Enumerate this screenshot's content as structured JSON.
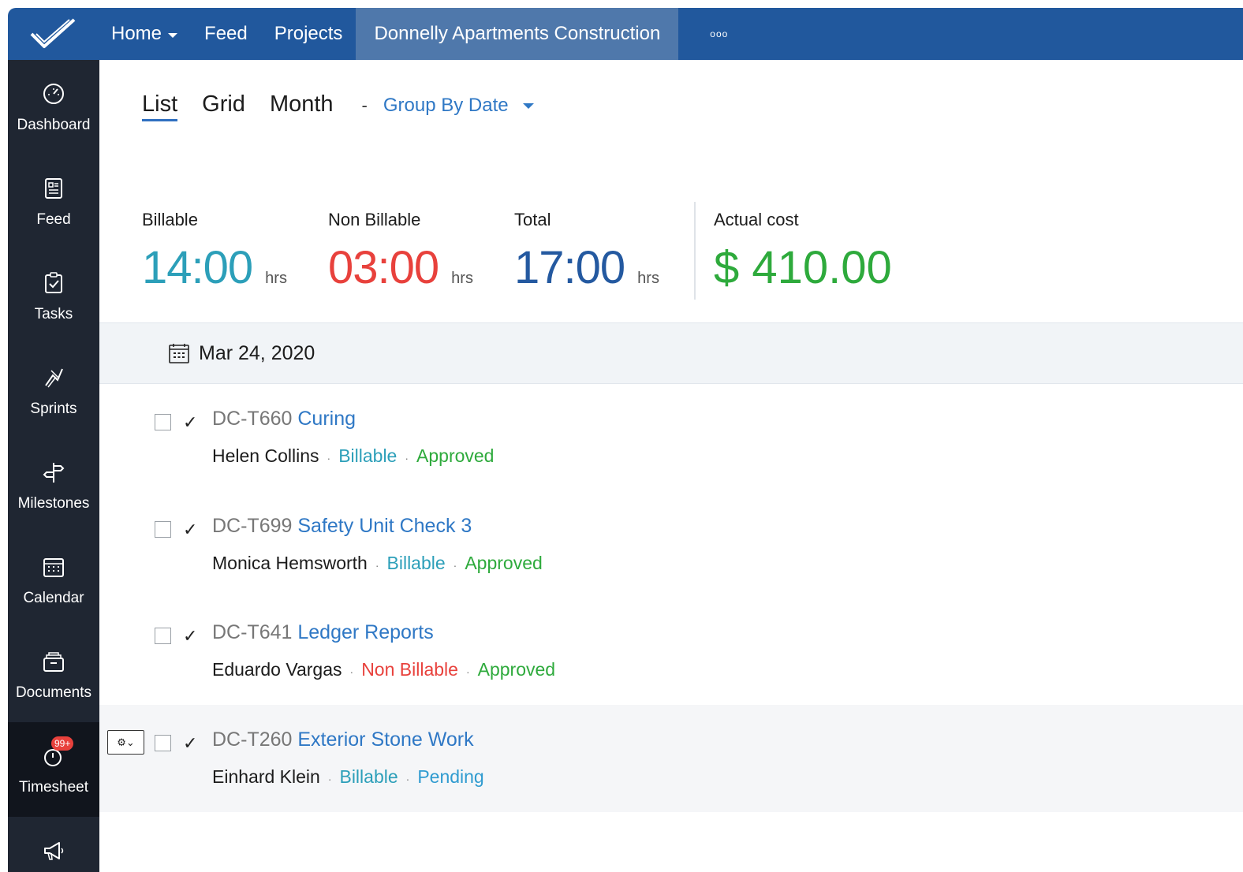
{
  "topbar": {
    "nav": [
      {
        "label": "Home"
      },
      {
        "label": "Feed"
      },
      {
        "label": "Projects"
      },
      {
        "label": "Donnelly Apartments Construction"
      }
    ],
    "more": "ooo"
  },
  "sidebar": {
    "items": [
      {
        "label": "Dashboard",
        "icon": "gauge-icon"
      },
      {
        "label": "Feed",
        "icon": "newspaper-icon"
      },
      {
        "label": "Tasks",
        "icon": "clipboard-check-icon"
      },
      {
        "label": "Sprints",
        "icon": "sprint-icon"
      },
      {
        "label": "Milestones",
        "icon": "signpost-icon"
      },
      {
        "label": "Calendar",
        "icon": "calendar-icon"
      },
      {
        "label": "Documents",
        "icon": "folders-icon"
      },
      {
        "label": "Timesheet",
        "icon": "timer-icon",
        "badge": "99+"
      },
      {
        "label": "",
        "icon": "megaphone-icon"
      }
    ]
  },
  "views": {
    "tabs": [
      "List",
      "Grid",
      "Month"
    ],
    "active": "List",
    "separator": "-",
    "group_by": "Group By Date"
  },
  "stats": {
    "billable": {
      "label": "Billable",
      "value": "14:00",
      "unit": "hrs",
      "color": "#2c9fb9"
    },
    "non_billable": {
      "label": "Non Billable",
      "value": "03:00",
      "unit": "hrs",
      "color": "#e8413c"
    },
    "total": {
      "label": "Total",
      "value": "17:00",
      "unit": "hrs",
      "color": "#2459a0"
    },
    "actual_cost": {
      "label": "Actual cost",
      "value": "$ 410.00",
      "color": "#2eaa3c"
    }
  },
  "date_group": "Mar 24, 2020",
  "entries": [
    {
      "id": "DC-T660",
      "name": "Curing",
      "user": "Helen Collins",
      "billing": "Billable",
      "status": "Approved"
    },
    {
      "id": "DC-T699",
      "name": "Safety Unit Check 3",
      "user": "Monica Hemsworth",
      "billing": "Billable",
      "status": "Approved"
    },
    {
      "id": "DC-T641",
      "name": "Ledger Reports",
      "user": "Eduardo Vargas",
      "billing": "Non Billable",
      "status": "Approved"
    },
    {
      "id": "DC-T260",
      "name": "Exterior Stone Work",
      "user": "Einhard Klein",
      "billing": "Billable",
      "status": "Pending"
    }
  ],
  "row_icons": {
    "tick": "✓",
    "gear": "⚙⌄"
  }
}
